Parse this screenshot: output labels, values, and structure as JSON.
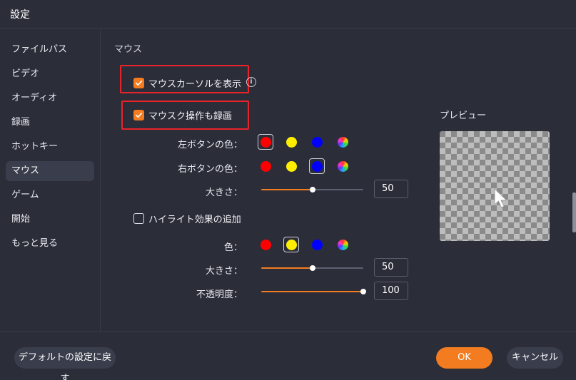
{
  "window": {
    "title": "設定"
  },
  "sidebar": {
    "items": [
      {
        "label": "ファイルパス"
      },
      {
        "label": "ビデオ"
      },
      {
        "label": "オーディオ"
      },
      {
        "label": "録画"
      },
      {
        "label": "ホットキー"
      },
      {
        "label": "マウス",
        "active": true
      },
      {
        "label": "ゲーム"
      },
      {
        "label": "開始"
      },
      {
        "label": "もっと見る"
      }
    ]
  },
  "mouse": {
    "section_title": "マウス",
    "show_cursor": {
      "label": "マウスカーソルを表示",
      "checked": true
    },
    "info_icon": "i",
    "record_clicks": {
      "label": "マウスク操作も録画",
      "checked": true
    },
    "left_button_color": {
      "label": "左ボタンの色：",
      "selected": "red"
    },
    "right_button_color": {
      "label": "右ボタンの色：",
      "selected": "blue"
    },
    "click_size": {
      "label": "大きさ：",
      "value": "50",
      "fraction": 0.5
    },
    "highlight": {
      "label": "ハイライト効果の追加",
      "checked": false
    },
    "highlight_color": {
      "label": "色：",
      "selected": "yellow"
    },
    "highlight_size": {
      "label": "大きさ：",
      "value": "50",
      "fraction": 0.5
    },
    "highlight_opacity": {
      "label": "不透明度：",
      "value": "100",
      "fraction": 1.0
    }
  },
  "palette": {
    "red": "#ff0000",
    "yellow": "#ffee00",
    "blue": "#0000ff",
    "multi": "multicolor-wheel",
    "accent": "#f47c20"
  },
  "preview": {
    "label": "プレビュー"
  },
  "footer": {
    "reset_label": "デフォルトの設定に戻す",
    "ok_label": "OK",
    "cancel_label": "キャンセル"
  }
}
